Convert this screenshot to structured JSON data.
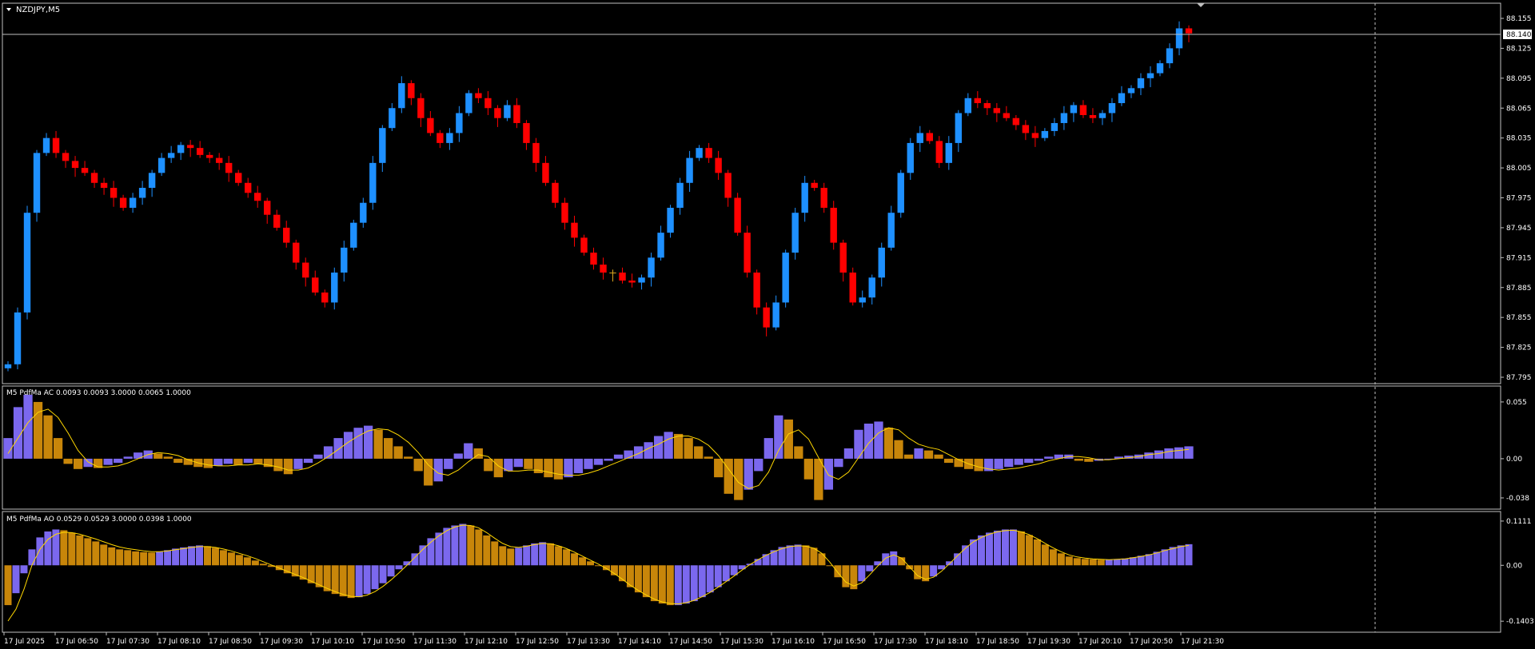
{
  "window": {
    "symbol_title": "NZDJPY,M5",
    "current_price": "88.140"
  },
  "price_axis": {
    "labels": [
      "88.155",
      "88.125",
      "88.095",
      "88.065",
      "88.035",
      "88.005",
      "87.975",
      "87.945",
      "87.915",
      "87.885",
      "87.855",
      "87.825",
      "87.795"
    ]
  },
  "time_axis": {
    "labels": [
      "17 Jul 2025",
      "17 Jul 06:50",
      "17 Jul 07:30",
      "17 Jul 08:10",
      "17 Jul 08:50",
      "17 Jul 09:30",
      "17 Jul 10:10",
      "17 Jul 10:50",
      "17 Jul 11:30",
      "17 Jul 12:10",
      "17 Jul 12:50",
      "17 Jul 13:30",
      "17 Jul 14:10",
      "17 Jul 14:50",
      "17 Jul 15:30",
      "17 Jul 16:10",
      "17 Jul 16:50",
      "17 Jul 17:30",
      "17 Jul 18:10",
      "17 Jul 18:50",
      "17 Jul 19:30",
      "17 Jul 20:10",
      "17 Jul 20:50",
      "17 Jul 21:30"
    ]
  },
  "indicators": {
    "ac": {
      "title": "M5 PdfMa AC 0.0093 0.0093 3.0000 0.0065 1.0000",
      "axis_labels": [
        "0.055",
        "0.00",
        "-0.038"
      ]
    },
    "ao": {
      "title": "M5 PdfMa AO 0.0529 0.0529 3.0000 0.0398 1.0000",
      "axis_labels": [
        "0.1111",
        "0.00",
        "-0.1403"
      ]
    }
  },
  "colors": {
    "background": "#000000",
    "bull": "#1e90ff",
    "bear": "#ff0000",
    "doji": "#daa520",
    "hist_up": "#7b68ee",
    "hist_down": "#c8860a",
    "signal_line": "#ffd700",
    "grid_border": "#c0c0c0"
  },
  "chart_data": [
    {
      "type": "candlestick",
      "title": "NZDJPY,M5",
      "ylim": [
        87.795,
        88.155
      ],
      "y_ticks": [
        88.155,
        88.125,
        88.095,
        88.065,
        88.035,
        88.005,
        87.975,
        87.945,
        87.915,
        87.885,
        87.855,
        87.825,
        87.795
      ],
      "close": [
        87.808,
        87.86,
        87.96,
        88.02,
        88.035,
        88.02,
        88.012,
        88.005,
        88.0,
        87.99,
        87.985,
        87.975,
        87.965,
        87.975,
        87.985,
        88.0,
        88.015,
        88.02,
        88.028,
        88.025,
        88.018,
        88.015,
        88.01,
        88.0,
        87.99,
        87.98,
        87.972,
        87.958,
        87.945,
        87.93,
        87.91,
        87.895,
        87.88,
        87.87,
        87.9,
        87.925,
        87.95,
        87.97,
        88.01,
        88.045,
        88.065,
        88.09,
        88.075,
        88.055,
        88.04,
        88.03,
        88.04,
        88.06,
        88.08,
        88.075,
        88.065,
        88.055,
        88.068,
        88.05,
        88.03,
        88.01,
        87.99,
        87.97,
        87.95,
        87.935,
        87.92,
        87.908,
        87.9,
        87.9,
        87.892,
        87.89,
        87.895,
        87.915,
        87.94,
        87.965,
        87.99,
        88.015,
        88.025,
        88.015,
        88.0,
        87.975,
        87.94,
        87.9,
        87.865,
        87.845,
        87.87,
        87.92,
        87.96,
        87.99,
        87.985,
        87.965,
        87.93,
        87.9,
        87.87,
        87.875,
        87.895,
        87.925,
        87.96,
        88.0,
        88.03,
        88.04,
        88.032,
        88.01,
        88.03,
        88.06,
        88.075,
        88.07,
        88.065,
        88.06,
        88.055,
        88.048,
        88.04,
        88.035,
        88.042,
        88.05,
        88.06,
        88.068,
        88.058,
        88.055,
        88.06,
        88.07,
        88.08,
        88.085,
        88.095,
        88.1,
        88.11,
        88.125,
        88.145,
        88.14
      ]
    },
    {
      "type": "bar",
      "title": "M5 PdfMa AC 0.0093 0.0093 3.0000 0.0065 1.0000",
      "ylim": [
        -0.045,
        0.065
      ],
      "y_ticks": [
        0.055,
        0.0,
        -0.038
      ],
      "values": [
        0.02,
        0.05,
        0.062,
        0.055,
        0.042,
        0.02,
        -0.005,
        -0.01,
        -0.008,
        -0.009,
        -0.006,
        -0.004,
        0.002,
        0.006,
        0.008,
        0.005,
        0.002,
        -0.004,
        -0.006,
        -0.008,
        -0.009,
        -0.007,
        -0.005,
        -0.006,
        -0.004,
        -0.005,
        -0.008,
        -0.012,
        -0.015,
        -0.01,
        -0.004,
        0.004,
        0.012,
        0.02,
        0.026,
        0.03,
        0.032,
        0.028,
        0.02,
        0.012,
        0.002,
        -0.012,
        -0.026,
        -0.022,
        -0.01,
        0.005,
        0.015,
        0.01,
        -0.012,
        -0.018,
        -0.012,
        -0.008,
        -0.01,
        -0.014,
        -0.018,
        -0.02,
        -0.018,
        -0.014,
        -0.01,
        -0.006,
        -0.002,
        0.004,
        0.008,
        0.012,
        0.016,
        0.022,
        0.026,
        0.024,
        0.02,
        0.012,
        0.002,
        -0.018,
        -0.034,
        -0.04,
        -0.03,
        -0.012,
        0.02,
        0.042,
        0.038,
        0.012,
        -0.02,
        -0.04,
        -0.03,
        -0.008,
        0.01,
        0.028,
        0.034,
        0.036,
        0.03,
        0.018,
        0.004,
        0.01,
        0.008,
        0.004,
        -0.004,
        -0.008,
        -0.01,
        -0.012,
        -0.012,
        -0.01,
        -0.008,
        -0.006,
        -0.004,
        -0.002,
        0.002,
        0.004,
        0.004,
        -0.002,
        -0.003,
        -0.002,
        0.0,
        0.002,
        0.003,
        0.004,
        0.006,
        0.008,
        0.01,
        0.011,
        0.012
      ],
      "signal": [
        0.005,
        0.02,
        0.035,
        0.045,
        0.048,
        0.04,
        0.025,
        0.008,
        -0.003,
        -0.008,
        -0.008,
        -0.007,
        -0.004,
        0.0,
        0.004,
        0.006,
        0.005,
        0.003,
        -0.001,
        -0.004,
        -0.006,
        -0.007,
        -0.007,
        -0.006,
        -0.006,
        -0.005,
        -0.006,
        -0.008,
        -0.011,
        -0.011,
        -0.009,
        -0.004,
        0.002,
        0.009,
        0.016,
        0.022,
        0.027,
        0.029,
        0.028,
        0.023,
        0.016,
        0.006,
        -0.006,
        -0.014,
        -0.016,
        -0.011,
        -0.003,
        0.004,
        0.002,
        -0.007,
        -0.012,
        -0.012,
        -0.011,
        -0.011,
        -0.013,
        -0.015,
        -0.016,
        -0.016,
        -0.014,
        -0.011,
        -0.007,
        -0.003,
        0.001,
        0.005,
        0.01,
        0.014,
        0.019,
        0.022,
        0.022,
        0.019,
        0.013,
        0.003,
        -0.01,
        -0.023,
        -0.029,
        -0.026,
        -0.013,
        0.008,
        0.024,
        0.028,
        0.019,
        0.001,
        -0.016,
        -0.02,
        -0.013,
        0.001,
        0.015,
        0.025,
        0.03,
        0.028,
        0.02,
        0.014,
        0.011,
        0.009,
        0.004,
        -0.001,
        -0.005,
        -0.008,
        -0.01,
        -0.011,
        -0.01,
        -0.009,
        -0.007,
        -0.005,
        -0.002,
        0.0,
        0.002,
        0.002,
        0.001,
        -0.001,
        -0.001,
        0.0,
        0.001,
        0.002,
        0.004,
        0.005,
        0.007,
        0.008,
        0.009
      ]
    },
    {
      "type": "bar",
      "title": "M5 PdfMa AO 0.0529 0.0529 3.0000 0.0398 1.0000",
      "ylim": [
        -0.16,
        0.125
      ],
      "y_ticks": [
        0.1111,
        0.0,
        -0.1403
      ],
      "values": [
        -0.1,
        -0.07,
        -0.02,
        0.04,
        0.07,
        0.085,
        0.09,
        0.088,
        0.082,
        0.075,
        0.068,
        0.06,
        0.052,
        0.045,
        0.04,
        0.038,
        0.035,
        0.033,
        0.032,
        0.034,
        0.038,
        0.042,
        0.045,
        0.048,
        0.05,
        0.048,
        0.044,
        0.038,
        0.032,
        0.026,
        0.02,
        0.012,
        0.004,
        -0.004,
        -0.012,
        -0.02,
        -0.028,
        -0.036,
        -0.045,
        -0.055,
        -0.065,
        -0.072,
        -0.078,
        -0.082,
        -0.08,
        -0.072,
        -0.06,
        -0.045,
        -0.028,
        -0.01,
        0.01,
        0.03,
        0.05,
        0.068,
        0.082,
        0.094,
        0.1,
        0.104,
        0.1,
        0.09,
        0.075,
        0.06,
        0.048,
        0.042,
        0.044,
        0.05,
        0.055,
        0.058,
        0.055,
        0.048,
        0.04,
        0.03,
        0.02,
        0.01,
        0.0,
        -0.012,
        -0.025,
        -0.04,
        -0.055,
        -0.068,
        -0.08,
        -0.09,
        -0.096,
        -0.1,
        -0.1,
        -0.096,
        -0.09,
        -0.08,
        -0.068,
        -0.055,
        -0.04,
        -0.025,
        -0.01,
        0.004,
        0.016,
        0.028,
        0.038,
        0.046,
        0.05,
        0.052,
        0.05,
        0.044,
        0.03,
        0.0,
        -0.03,
        -0.055,
        -0.06,
        -0.04,
        -0.015,
        0.01,
        0.03,
        0.035,
        0.02,
        -0.01,
        -0.035,
        -0.04,
        -0.028,
        -0.01,
        0.01,
        0.03,
        0.05,
        0.065,
        0.075,
        0.082,
        0.087,
        0.09,
        0.09,
        0.085,
        0.076,
        0.065,
        0.052,
        0.04,
        0.03,
        0.022,
        0.018,
        0.016,
        0.015,
        0.014,
        0.014,
        0.015,
        0.017,
        0.02,
        0.024,
        0.028,
        0.034,
        0.04,
        0.046,
        0.05,
        0.053
      ],
      "signal": [
        -0.14,
        -0.11,
        -0.06,
        0.0,
        0.04,
        0.065,
        0.078,
        0.083,
        0.082,
        0.078,
        0.072,
        0.066,
        0.059,
        0.052,
        0.046,
        0.042,
        0.039,
        0.036,
        0.034,
        0.034,
        0.036,
        0.039,
        0.042,
        0.045,
        0.047,
        0.047,
        0.045,
        0.041,
        0.036,
        0.03,
        0.024,
        0.017,
        0.009,
        0.001,
        -0.007,
        -0.015,
        -0.023,
        -0.031,
        -0.04,
        -0.049,
        -0.058,
        -0.066,
        -0.073,
        -0.078,
        -0.079,
        -0.075,
        -0.066,
        -0.053,
        -0.037,
        -0.019,
        0.0,
        0.02,
        0.04,
        0.058,
        0.074,
        0.087,
        0.096,
        0.101,
        0.1,
        0.094,
        0.082,
        0.068,
        0.055,
        0.047,
        0.045,
        0.048,
        0.052,
        0.055,
        0.054,
        0.049,
        0.042,
        0.033,
        0.023,
        0.013,
        0.003,
        -0.008,
        -0.021,
        -0.035,
        -0.05,
        -0.063,
        -0.075,
        -0.085,
        -0.092,
        -0.096,
        -0.097,
        -0.094,
        -0.088,
        -0.079,
        -0.068,
        -0.055,
        -0.041,
        -0.027,
        -0.012,
        0.002,
        0.014,
        0.025,
        0.034,
        0.042,
        0.047,
        0.049,
        0.048,
        0.043,
        0.03,
        0.008,
        -0.018,
        -0.042,
        -0.052,
        -0.044,
        -0.024,
        -0.002,
        0.018,
        0.026,
        0.018,
        -0.004,
        -0.026,
        -0.035,
        -0.03,
        -0.015,
        0.004,
        0.024,
        0.043,
        0.059,
        0.07,
        0.078,
        0.084,
        0.087,
        0.088,
        0.084,
        0.077,
        0.067,
        0.055,
        0.044,
        0.034,
        0.026,
        0.021,
        0.018,
        0.016,
        0.015,
        0.014,
        0.015,
        0.016,
        0.019,
        0.022,
        0.026,
        0.031,
        0.037,
        0.042,
        0.047,
        0.05
      ]
    }
  ]
}
